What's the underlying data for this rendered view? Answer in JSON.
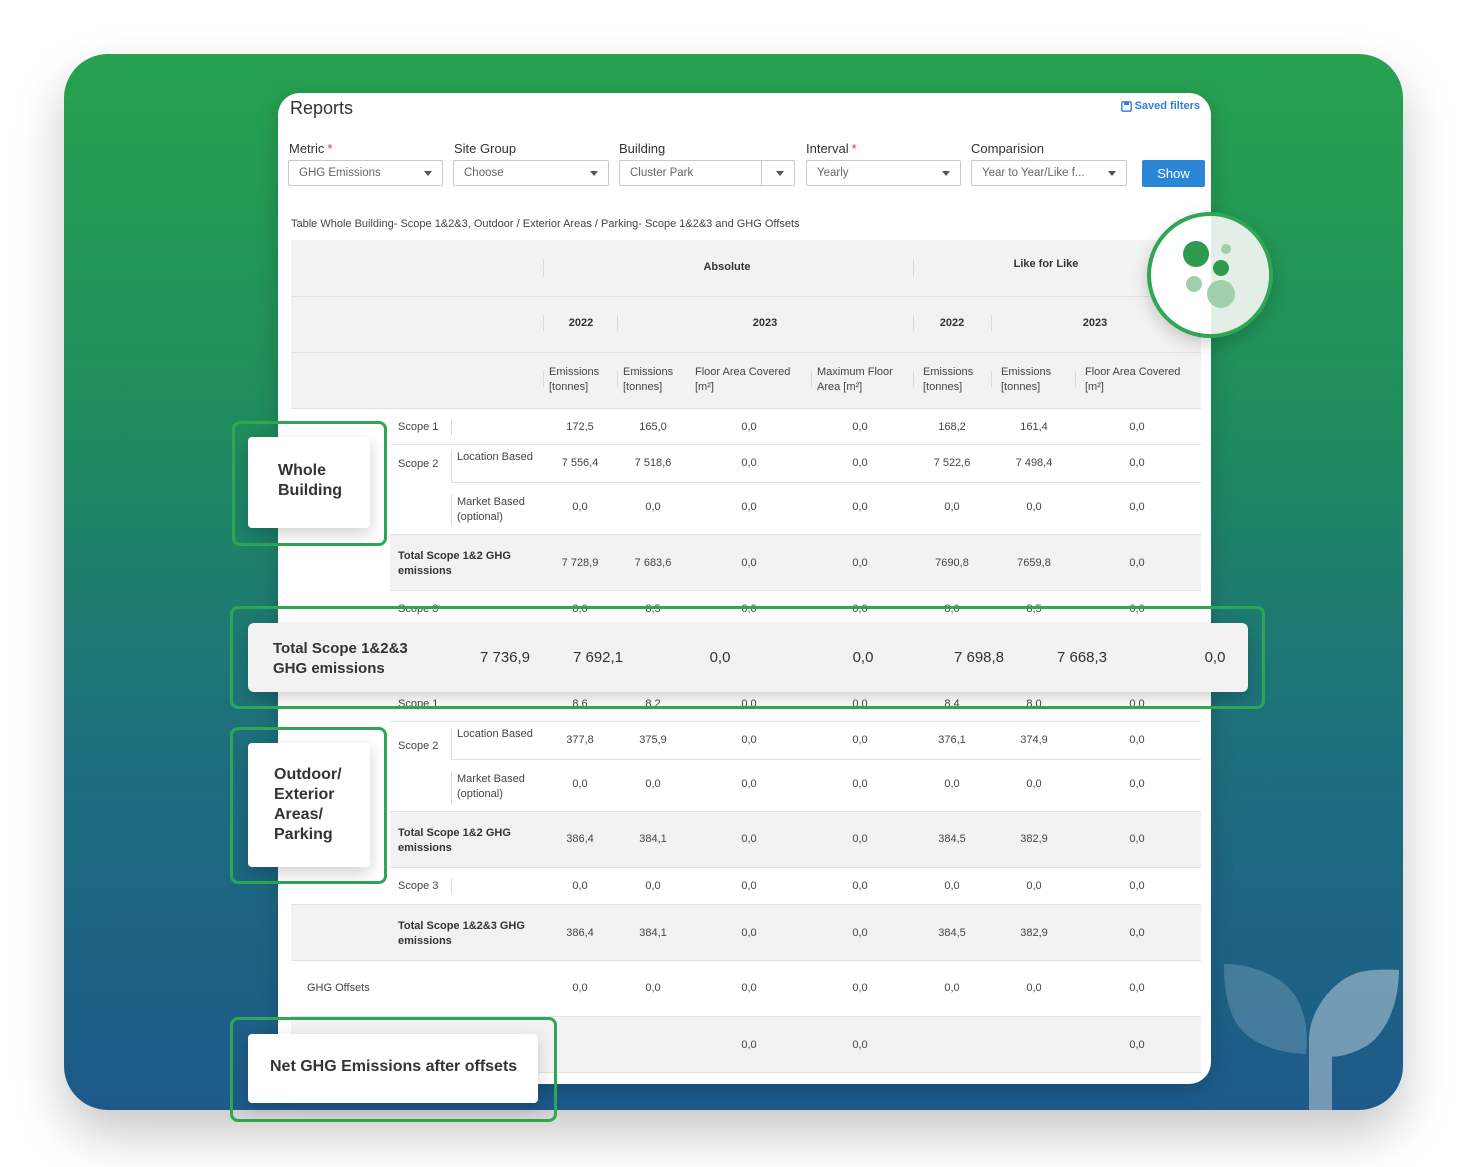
{
  "header": {
    "title": "Reports",
    "saved_filters": "Saved filters"
  },
  "filters": {
    "metric": {
      "label": "Metric",
      "value": "GHG Emissions"
    },
    "site_group": {
      "label": "Site Group",
      "value": "Choose"
    },
    "building": {
      "label": "Building",
      "value": "Cluster Park"
    },
    "interval": {
      "label": "Interval",
      "value": "Yearly"
    },
    "comparison": {
      "label": "Comparision",
      "value": "Year to Year/Like f..."
    },
    "required_mark": "*",
    "show_button": "Show"
  },
  "table": {
    "caption": "Table Whole Building- Scope 1&2&3, Outdoor / Exterior Areas / Parking- Scope 1&2&3 and GHG Offsets",
    "group_headers": {
      "absolute": "Absolute",
      "like_for_like": "Like for Like"
    },
    "year_headers": {
      "abs_2022": "2022",
      "abs_2023": "2023",
      "lfl_2022": "2022",
      "lfl_2023": "2023"
    },
    "columns": [
      "Emissions [tonnes]",
      "Emissions [tonnes]",
      "Floor Area Covered [m²]",
      "Maximum Floor Area [m²]",
      "Emissions [tonnes]",
      "Emissions [tonnes]",
      "Floor Area Covered [m²]"
    ],
    "whole_building": {
      "scope1": {
        "label": "Scope 1",
        "values": [
          "172,5",
          "165,0",
          "0,0",
          "0,0",
          "168,2",
          "161,4",
          "0,0"
        ]
      },
      "scope2_label": "Scope 2",
      "scope2_location": {
        "label": "Location Based",
        "values": [
          "7 556,4",
          "7 518,6",
          "0,0",
          "0,0",
          "7 522,6",
          "7 498,4",
          "0,0"
        ]
      },
      "scope2_market": {
        "label": "Market Based (optional)",
        "values": [
          "0,0",
          "0,0",
          "0,0",
          "0,0",
          "0,0",
          "0,0",
          "0,0"
        ]
      },
      "total12": {
        "label": "Total Scope 1&2 GHG emissions",
        "values": [
          "7 728,9",
          "7 683,6",
          "0,0",
          "0,0",
          "7690,8",
          "7659,8",
          "0,0"
        ]
      },
      "scope3": {
        "label": "Scope 3",
        "values": [
          "8,0",
          "8,5",
          "0,0",
          "0,0",
          "8,0",
          "8,5",
          "0,0"
        ]
      },
      "total123": {
        "label": "Total Scope 1&2&3 GHG emissions",
        "values": [
          "7 736,9",
          "7 692,1",
          "0,0",
          "0,0",
          "7 698,8",
          "7 668,3",
          "0,0"
        ]
      }
    },
    "outdoor": {
      "scope1": {
        "label": "Scope 1",
        "values": [
          "8,6",
          "8,2",
          "0,0",
          "0,0",
          "8,4",
          "8,0",
          "0,0"
        ]
      },
      "scope2_label": "Scope 2",
      "scope2_location": {
        "label": "Location Based",
        "values": [
          "377,8",
          "375,9",
          "0,0",
          "0,0",
          "376,1",
          "374,9",
          "0,0"
        ]
      },
      "scope2_market": {
        "label": "Market Based (optional)",
        "values": [
          "0,0",
          "0,0",
          "0,0",
          "0,0",
          "0,0",
          "0,0",
          "0,0"
        ]
      },
      "total12": {
        "label": "Total Scope 1&2 GHG emissions",
        "values": [
          "386,4",
          "384,1",
          "0,0",
          "0,0",
          "384,5",
          "382,9",
          "0,0"
        ]
      },
      "scope3": {
        "label": "Scope 3",
        "values": [
          "0,0",
          "0,0",
          "0,0",
          "0,0",
          "0,0",
          "0,0",
          "0,0"
        ]
      },
      "total123": {
        "label": "Total Scope 1&2&3 GHG emissions",
        "values": [
          "386,4",
          "384,1",
          "0,0",
          "0,0",
          "384,5",
          "382,9",
          "0,0"
        ]
      }
    },
    "ghg_offsets": {
      "label": "GHG Offsets",
      "values": [
        "0,0",
        "0,0",
        "0,0",
        "0,0",
        "0,0",
        "0,0",
        "0,0"
      ]
    },
    "net": {
      "label": "Net GHG Emissions after offsets",
      "values": [
        "",
        "",
        "0,0",
        "0,0",
        "",
        "",
        "0,0"
      ]
    }
  },
  "callouts": {
    "whole_building": "Whole Building",
    "outdoor": "Outdoor/ Exterior Areas/ Parking",
    "total123": "Total Scope 1&2&3 GHG emissions",
    "net": "Net GHG Emissions after offsets"
  },
  "colors": {
    "accent_green": "#2ea653",
    "button_blue": "#2c86d6",
    "link_blue": "#2f7fd3"
  },
  "icons": [
    "save-icon",
    "caret-down-icon",
    "bubble-logo-icon",
    "sprout-leaf-icon"
  ]
}
